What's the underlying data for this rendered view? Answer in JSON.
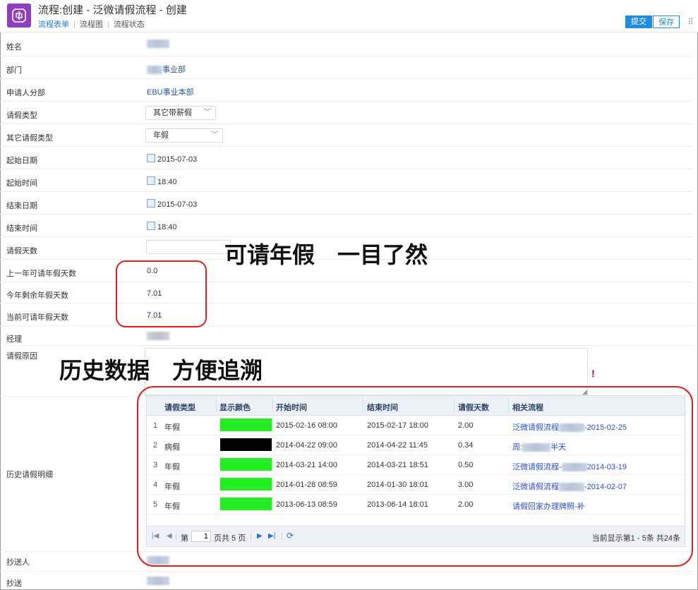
{
  "header": {
    "title": "流程:创建 - 泛微请假流程 - 创建",
    "tabs": [
      "流程表单",
      "流程图",
      "流程状态"
    ],
    "submit_label": "提交",
    "save_label": "保存",
    "accent_color": "#1e8ce0",
    "app_icon_color": "#8d3fbf"
  },
  "form": {
    "name": {
      "label": "姓名"
    },
    "department": {
      "label": "部门",
      "value_suffix": "事业部"
    },
    "branch": {
      "label": "申请人分部",
      "value": "EBU事业本部"
    },
    "leave_type": {
      "label": "请假类型",
      "value": "其它带薪假"
    },
    "other_leave_type": {
      "label": "其它请假类型",
      "value": "年假"
    },
    "start_date": {
      "label": "起始日期",
      "value": "2015-07-03"
    },
    "start_time": {
      "label": "起始时间",
      "value": "18:40"
    },
    "end_date": {
      "label": "结束日期",
      "value": "2015-07-03"
    },
    "end_time": {
      "label": "结束时间",
      "value": "18:40"
    },
    "leave_days": {
      "label": "请假天数",
      "value": ""
    },
    "last_year_days": {
      "label": "上一年可请年假天数",
      "value": "0.0"
    },
    "remaining_days": {
      "label": "今年剩余年假天数",
      "value": "7.01"
    },
    "available_days": {
      "label": "当前可请年假天数",
      "value": "7.01"
    },
    "manager": {
      "label": "经理"
    },
    "reason": {
      "label": "请假原因",
      "value": "",
      "required_mark": "!"
    },
    "history": {
      "label": "历史请假明细"
    },
    "cc_person": {
      "label": "抄送人"
    },
    "cc": {
      "label": "抄送"
    }
  },
  "annotations": {
    "annual_leave": "可请年假　一目了然",
    "history": "历史数据　方便追溯"
  },
  "history_grid": {
    "columns": [
      "请假类型",
      "显示颜色",
      "开始时间",
      "结束时间",
      "请假天数",
      "相关流程"
    ],
    "rows": [
      {
        "idx": "1",
        "type": "年假",
        "color": "#22ee22",
        "start": "2015-02-16 08:00",
        "end": "2015-02-17 18:00",
        "days": "2.00",
        "flow_prefix": "泛微请假流程",
        "flow_suffix": "-2015-02-25"
      },
      {
        "idx": "2",
        "type": "病假",
        "color": "#000000",
        "start": "2014-04-22 09:00",
        "end": "2014-04-22 11:45",
        "days": "0.34",
        "flow_prefix": "周:",
        "flow_suffix": "半天"
      },
      {
        "idx": "3",
        "type": "年假",
        "color": "#22ee22",
        "start": "2014-03-21 14:00",
        "end": "2014-03-21 18:51",
        "days": "0.50",
        "flow_prefix": "泛微请假流程-",
        "flow_suffix": "2014-03-19"
      },
      {
        "idx": "4",
        "type": "年假",
        "color": "#22ee22",
        "start": "2014-01-28 08:59",
        "end": "2014-01-30 18:01",
        "days": "3.00",
        "flow_prefix": "泛微请假流程",
        "flow_suffix": "-2014-02-07"
      },
      {
        "idx": "5",
        "type": "年假",
        "color": "#22ee22",
        "start": "2013-06-13 08:59",
        "end": "2013-06-14 18:01",
        "days": "2.00",
        "flow_prefix": "请假回家办理牌照-补",
        "flow_suffix": ""
      }
    ],
    "pager": {
      "page_prefix": "第",
      "page_value": "1",
      "page_suffix": "页共 5 页",
      "summary": "当前显示第1 - 5条 共24条"
    }
  },
  "highlight_color": "#e0201c"
}
